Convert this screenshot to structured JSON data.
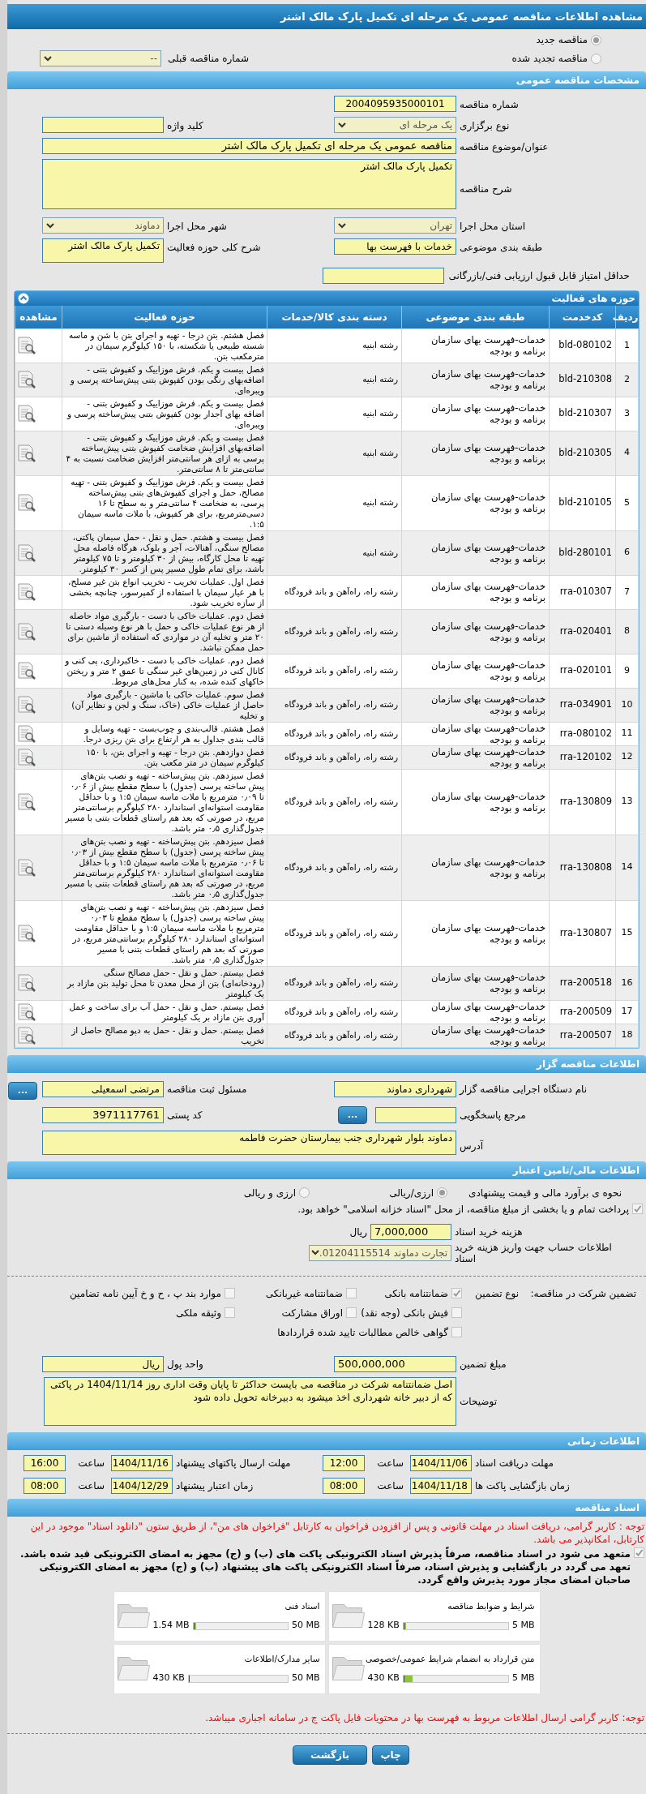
{
  "title": "مشاهده اطلاعات مناقصه عمومی یک مرحله ای تکمیل پارک مالک اشتر",
  "tender_status": [
    {
      "label": "مناقصه جدید",
      "selected": true
    },
    {
      "label": "مناقصه تجدید شده",
      "selected": false
    }
  ],
  "previous_tender": {
    "label": "شماره مناقصه قبلی",
    "value": "--"
  },
  "general": {
    "heading": "مشخصات مناقصه عمومی",
    "tender_number": {
      "label": "شماره مناقصه",
      "value": "2004095935000101"
    },
    "holding_type": {
      "label": "نوع برگزاری",
      "value": "یک مرحله ای"
    },
    "keyword": {
      "label": "کلید واژه"
    },
    "subject": {
      "label": "عنوان/موضوع مناقصه",
      "value": "مناقصه عمومی یک مرحله ای تکمیل پارک مالک اشتر"
    },
    "description": {
      "label": "شرح مناقصه",
      "value": "تکمیل پارک مالک اشتر"
    },
    "province": {
      "label": "استان محل اجرا",
      "value": "تهران"
    },
    "city": {
      "label": "شهر محل اجرا",
      "value": "دماوند"
    },
    "category": {
      "label": "طبقه بندی موضوعی",
      "value": "خدمات با فهرست بها"
    },
    "activity_summary": {
      "label": "شرح کلی حوزه فعالیت",
      "value": "تکمیل پارک مالک اشتر"
    },
    "min_score": {
      "label": "حداقل امتیاز قابل قبول ارزیابی فنی/بازرگانی"
    }
  },
  "activities": {
    "heading": "حوزه های فعالیت",
    "expanded": true,
    "columns": [
      "ردیف",
      "کدخدمت",
      "طبقه بندی موضوعی",
      "دسته بندی کالا/خدمات",
      "حوزه فعالیت",
      "مشاهده"
    ],
    "rows": [
      {
        "index": "1",
        "code": "bld-080102",
        "category": "خدمات-فهرست بهای سازمان برنامه و بودجه",
        "group": "رشته ابنیه",
        "scope": "فصل هشتم. بتن درجا - تهیه و اجرای بتن با شن و ماسه شسته طبیعی یا شکسته، با ۱۵۰ کیلوگرم سیمان در مترمکعب بتن."
      },
      {
        "index": "2",
        "code": "bld-210308",
        "category": "خدمات-فهرست بهای سازمان برنامه و بودجه",
        "group": "رشته ابنیه",
        "scope": "فصل بیست و یکم. فرش موزاییک و کفپوش بتنی - اضافه‌بهای رنگی بودن کفپوش بتنی پیش‌ساخته پرسی و ویبره‌ای."
      },
      {
        "index": "3",
        "code": "bld-210307",
        "category": "خدمات-فهرست بهای سازمان برنامه و بودجه",
        "group": "رشته ابنیه",
        "scope": "فصل بیست و یکم. فرش موزاییک و کفپوش بتنی - اضافه بهای آجدار بودن کفپوش بتنی پیش‌ساخته پرسی و ویبره‌ای."
      },
      {
        "index": "4",
        "code": "bld-210305",
        "category": "خدمات-فهرست بهای سازمان برنامه و بودجه",
        "group": "رشته ابنیه",
        "scope": "فصل بیست و یکم. فرش موزاییک و کفپوش بتنی - اضافه‌بهای افزایش ضخامت کفپوش بتنی پیش‌ساخته پرسی به ازای هر سانتی‌متر افزایش ضخامت نسبت به ۴ سانتی‌متر تا ۸ سانتی‌متر."
      },
      {
        "index": "5",
        "code": "bld-210105",
        "category": "خدمات-فهرست بهای سازمان برنامه و بودجه",
        "group": "رشته ابنیه",
        "scope": "فصل بیست و یکم. فرش موزاییک و کفپوش بتنی - تهیه مصالح، حمل و اجرای کفپوش‌های بتنی پیش‌ساخته پرسی، به ضخامت ۴ سانتی‌متر و به سطح تا ۱۶ دسی‌مترمربع، برای هر کفپوش، با ملات ماسه سیمان ۱:۵."
      },
      {
        "index": "6",
        "code": "bld-280101",
        "category": "خدمات-فهرست بهای سازمان برنامه و بودجه",
        "group": "رشته ابنیه",
        "scope": "فصل بیست و هشتم. حمل و نقل - حمل سیمان پاکتی، مصالح سنگی، آهنالات، آجر و بلوک، هرگاه فاصله محل تهیه تا محل کارگاه، بیش از ۳۰ کیلومتر و تا ۷۵ کیلومتر باشد، برای تمام طول مسیر پس از کسر ۳۰ کیلومتر."
      },
      {
        "index": "7",
        "code": "rra-010307",
        "category": "خدمات-فهرست بهای سازمان برنامه و بودجه",
        "group": "رشته راه، راه‌آهن و باند فرودگاه",
        "scope": "فصل اول. عملیات تخریب - تخریب انواع بتن غیر مسلح، با هر عیار سیمان با استفاده از کمپرسور، چنانچه بخشی از سازه تخریب شود."
      },
      {
        "index": "8",
        "code": "rra-020401",
        "category": "خدمات-فهرست بهای سازمان برنامه و بودجه",
        "group": "رشته راه، راه‌آهن و باند فرودگاه",
        "scope": "فصل دوم. عملیات خاکی با دست - بارگیری مواد حاصله از هر نوع عملیات خاکی و حمل با هر نوع وسیله دستی تا ۲۰ متر و تخلیه آن در مواردی که استفاده از ماشین برای حمل ممکن نباشد."
      },
      {
        "index": "9",
        "code": "rra-020101",
        "category": "خدمات-فهرست بهای سازمان برنامه و بودجه",
        "group": "رشته راه، راه‌آهن و باند فرودگاه",
        "scope": "فصل دوم. عملیات خاکی با دست - خاکبرداری، پی کنی و کانال کنی در زمین‌های غیر سنگی تا عمق ۲ متر و ریختن خاکهای کنده شده، به کنار محل‌های مربوط."
      },
      {
        "index": "10",
        "code": "rra-034901",
        "category": "خدمات-فهرست بهای سازمان برنامه و بودجه",
        "group": "رشته راه، راه‌آهن و باند فرودگاه",
        "scope": "فصل سوم. عملیات خاکی با ماشین - بارگیری مواد حاصل از عملیات خاکی (خاک، سنگ و لجن و نظایر آن) و تخلیه"
      },
      {
        "index": "11",
        "code": "rra-080102",
        "category": "خدمات-فهرست بهای سازمان برنامه و بودجه",
        "group": "رشته راه، راه‌آهن و باند فرودگاه",
        "scope": "فصل هشتم. قالب‌بندی و چوب‌بست - تهیه وسایل و قالب بندی جداول به هر ارتفاع برای بتن ریزی درجا."
      },
      {
        "index": "12",
        "code": "rra-120102",
        "category": "خدمات-فهرست بهای سازمان برنامه و بودجه",
        "group": "رشته راه، راه‌آهن و باند فرودگاه",
        "scope": "فصل دوازدهم. بتن درجا - تهیه و اجرای بتن، با ۱۵۰ کیلوگرم سیمان در متر مکعب بتن."
      },
      {
        "index": "13",
        "code": "rra-130809",
        "category": "خدمات-فهرست بهای سازمان برنامه و بودجه",
        "group": "رشته راه، راه‌آهن و باند فرودگاه",
        "scope": "فصل سیزدهم. بتن پیش‌ساخته - تهیه و نصب بتن‌های پیش ساخته پرسی (جدول) با سطح مقطع بیش از ۰٫۰۶ تا ۰٫۰۹ مترمربع با ملات ماسه سیمان ۱:۵ و با حداقل مقاومت استوانه‌ای استاندارد ۲۸۰ کیلوگرم برسانتی‌متر مربع، در صورتی که بعد هم راستای قطعات بتنی با مسیر جدول‌گذاری ۰٫۵ متر باشد."
      },
      {
        "index": "14",
        "code": "rra-130808",
        "category": "خدمات-فهرست بهای سازمان برنامه و بودجه",
        "group": "رشته راه، راه‌آهن و باند فرودگاه",
        "scope": "فصل سیزدهم. بتن پیش‌ساخته - تهیه و نصب بتن‌های پیش ساخته پرسی (جدول) با سطح مقطع بیش از ۰٫۰۳ تا ۰٫۰۶ مترمربع با ملات ماسه سیمان ۱:۵ و با حداقل مقاومت استوانه‌ای استاندارد ۲۸۰ کیلوگرم برسانتی‌متر مربع، در صورتی که بعد هم راستای قطعات بتنی با مسیر جدول‌گذاری ۰٫۵ متر باشد."
      },
      {
        "index": "15",
        "code": "rra-130807",
        "category": "خدمات-فهرست بهای سازمان برنامه و بودجه",
        "group": "رشته راه، راه‌آهن و باند فرودگاه",
        "scope": "فصل سیزدهم. بتن پیش‌ساخته - تهیه و نصب بتن‌های پیش ساخته پرسی (جدول) با سطح مقطع تا ۰٫۰۳ مترمربع با ملات ماسه سیمان ۱:۵ و با حداقل مقاومت استوانه‌ای استاندارد ۲۸۰ کیلوگرم برسانتی‌متر مربع، در صورتی که بعد هم راستای قطعات بتنی با مسیر جدول‌گذاری ۰٫۵ متر باشد."
      },
      {
        "index": "16",
        "code": "rra-200518",
        "category": "خدمات-فهرست بهای سازمان برنامه و بودجه",
        "group": "رشته راه، راه‌آهن و باند فرودگاه",
        "scope": "فصل بیستم. حمل و نقل - حمل مصالح سنگی (رودخانه‌ای) بتن از محل معدن تا محل تولید بتن مازاد بر یک کیلومتر"
      },
      {
        "index": "17",
        "code": "rra-200509",
        "category": "خدمات-فهرست بهای سازمان برنامه و بودجه",
        "group": "رشته راه، راه‌آهن و باند فرودگاه",
        "scope": "فصل بیستم. حمل و نقل - حمل آب برای ساخت و عمل آوری بتن مازاد بر یک کیلومتر"
      },
      {
        "index": "18",
        "code": "rra-200507",
        "category": "خدمات-فهرست بهای سازمان برنامه و بودجه",
        "group": "رشته راه، راه‌آهن و باند فرودگاه",
        "scope": "فصل بیستم. حمل و نقل - حمل به دپو مصالح حاصل از تخریب"
      }
    ]
  },
  "organizer": {
    "heading": "اطلاعات مناقصه گزار",
    "agency": {
      "label": "نام دستگاه اجرایی مناقصه گزار",
      "value": "شهرداری دماوند"
    },
    "registrar": {
      "label": "مسئول ثبت مناقصه",
      "value": "مرتضی اسمعیلی",
      "button": "..."
    },
    "reference": {
      "label": "مرجع پاسخگویی",
      "button": "..."
    },
    "postal_code": {
      "label": "کد پستی",
      "value": "3971117761"
    },
    "address": {
      "label": "آدرس",
      "value": "دماوند بلوار شهرداری  جنب بیمارستان حضرت فاطمه"
    }
  },
  "financial": {
    "heading": "اطلاعات مالی/تامین اعتبار",
    "estimate": {
      "label": "نحوه ی برآورد مالی و قیمت پیشنهادی",
      "options": [
        {
          "label": "ارزی/ریالی",
          "selected": true
        },
        {
          "label": "ارزی و ریالی",
          "selected": false
        }
      ]
    },
    "treasury": {
      "label": "پرداخت تمام و یا بخشی از مبلغ مناقصه، از محل \"اسناد خزانه اسلامی\" خواهد بود.",
      "checked": true
    },
    "document_fee": {
      "label": "هزینه خرید اسناد",
      "value": "7,000,000",
      "unit": "ریال"
    },
    "account": {
      "label": "اطلاعات حساب جهت واریز هزینه خرید اسناد",
      "value": "تجارت دماوند 01204115514."
    },
    "guarantee": {
      "label": "تضمین شرکت در مناقصه:",
      "type_label": "نوع تضمین",
      "options": [
        {
          "label": "ضمانتنامه بانکی",
          "checked": true
        },
        {
          "label": "ضمانتنامه غیربانکی",
          "checked": false
        },
        {
          "label": "موارد بند پ ، ح و خ آیین نامه تضامین",
          "checked": false
        },
        {
          "label": "فیش بانکی (وجه نقد)",
          "checked": false
        },
        {
          "label": "اوراق مشارکت",
          "checked": false
        },
        {
          "label": "وثیقه ملکی",
          "checked": false
        },
        {
          "label": "گواهی خالص مطالبات تایید شده قراردادها",
          "checked": false
        }
      ]
    },
    "amount": {
      "label": "مبلغ تضمین",
      "value": "500,000,000"
    },
    "currency": {
      "label": "واحد پول",
      "value": "ریال"
    },
    "notes": {
      "label": "توضیحات",
      "value": "اصل ضمانتنامه شرکت در مناقصه می بایست حداکثر تا پایان وقت اداری روز 1404/11/14 در پاکتی که از دبیر خانه شهرداری اخذ میشود به دبیرخانه تحویل داده شود"
    }
  },
  "schedule": {
    "heading": "اطلاعات زمانی",
    "items": [
      {
        "label": "مهلت دریافت اسناد",
        "date": "1404/11/06",
        "time_label": "ساعت",
        "time": "12:00"
      },
      {
        "label": "مهلت ارسال پاکتهای پیشنهاد",
        "date": "1404/11/16",
        "time_label": "ساعت",
        "time": "16:00"
      },
      {
        "label": "زمان بازگشایی پاکت ها",
        "date": "1404/11/18",
        "time_label": "ساعت",
        "time": "08:00"
      },
      {
        "label": "زمان اعتبار پیشنهاد",
        "date": "1404/12/29",
        "time_label": "ساعت",
        "time": "08:00"
      }
    ]
  },
  "documents": {
    "heading": "اسناد مناقصه",
    "notice": "توجه : کاربر گرامی، دریافت اسناد در مهلت قانونی و پس از افزودن فراخوان به کارتابل \"فراخوان های من\"، از طریق ستون \"دانلود اسناد\" موجود در این کارتابل، امکانپذیر می باشد.",
    "commitment": {
      "label": "متعهد می شود در اسناد مناقصه، صرفاً پذیرش اسناد الکترونیکی پاکت های (ب) و (ج) مجهز به امضای الکترونیکی قید شده باشد. تعهد می گردد در بازگشایی و پذیرش اسناد، صرفاً اسناد الکترونیکی پاکت های پیشنهاد (ب) و (ج) مجهز به امضای الکترونیکی صاحبان امضای مجاز مورد پذیرش واقع گردد.",
      "checked": true
    },
    "files": [
      {
        "name": "شرایط و ضوابط مناقصه",
        "size": "128 KB",
        "max": "5 MB",
        "level": 0.025
      },
      {
        "name": "اسناد فنی",
        "size": "1.54 MB",
        "max": "50 MB",
        "level": 0.03
      },
      {
        "name": "متن قرارداد به انضمام شرایط عمومی/خصوصی",
        "size": "430 KB",
        "max": "5 MB",
        "level": 0.084
      },
      {
        "name": "سایر مدارک/اطلاعات",
        "size": "430 KB",
        "max": "50 MB",
        "level": 0.008
      }
    ],
    "footer_notice": "توجه: کاربر گرامی ارسال اطلاعات مربوط به فهرست بها در محتویات فایل پاکت ج در سامانه اجباری میباشد."
  },
  "buttons": [
    {
      "label": "چاپ"
    },
    {
      "label": "بازگشت"
    }
  ]
}
